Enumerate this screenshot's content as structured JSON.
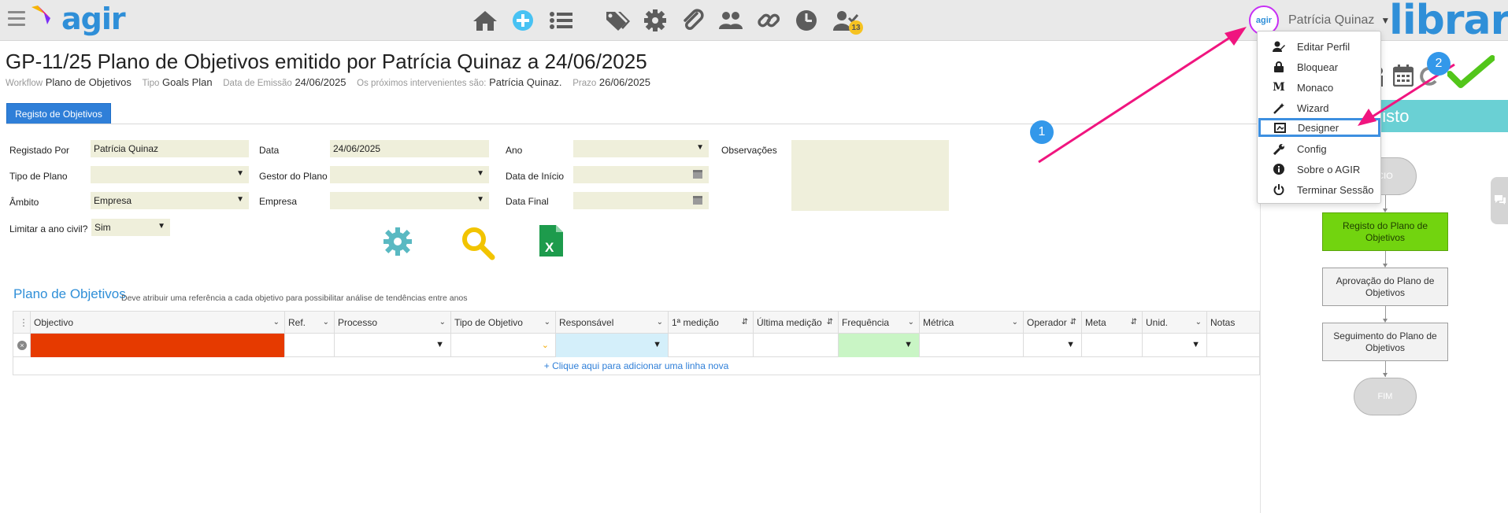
{
  "topbar": {
    "logo_text": "agir",
    "user_name": "Patrícia Quinaz",
    "user_avatar_text": "agir",
    "library_text": "library",
    "notification_count": "13",
    "nav_icons": [
      "home-icon",
      "add-icon",
      "list-icon",
      "tags-icon",
      "gear-icon",
      "attachment-icon",
      "users-icon",
      "link-icon",
      "clock-icon",
      "user-check-icon"
    ]
  },
  "page": {
    "title": "GP-11/25 Plano de Objetivos emitido por Patrícia Quinaz a 24/06/2025",
    "meta": {
      "workflow_label": "Workflow",
      "workflow_value": "Plano de Objetivos",
      "tipo_label": "Tipo",
      "tipo_value": "Goals Plan",
      "data_emissao_label": "Data de Emissão",
      "data_emissao_value": "24/06/2025",
      "intervenientes_label": "Os próximos intervenientes são:",
      "intervenientes_value": "Patrícia Quinaz.",
      "prazo_label": "Prazo",
      "prazo_value": "26/06/2025"
    },
    "tab_label": "Registo de Objetivos"
  },
  "form": {
    "registado_por_label": "Registado Por",
    "registado_por_value": "Patrícia Quinaz",
    "data_label": "Data",
    "data_value": "24/06/2025",
    "ano_label": "Ano",
    "ano_value": "",
    "observacoes_label": "Observações",
    "tipo_plano_label": "Tipo de Plano",
    "tipo_plano_value": "",
    "gestor_label": "Gestor do Plano",
    "gestor_value": "",
    "data_inicio_label": "Data de Início",
    "data_inicio_value": "",
    "ambito_label": "Âmbito",
    "ambito_value": "Empresa",
    "empresa_label": "Empresa",
    "empresa_value": "",
    "data_final_label": "Data Final",
    "data_final_value": "",
    "limitar_label": "Limitar a ano civil?",
    "limitar_value": "Sim"
  },
  "table": {
    "title": "Plano de Objetivos",
    "subtitle": "Deve atribuir uma referência a cada objetivo para possibilitar análise de tendências entre anos",
    "columns": [
      "Objectivo",
      "Ref.",
      "Processo",
      "Tipo de Objetivo",
      "Responsável",
      "1ª medição",
      "Última medição",
      "Frequência",
      "Métrica",
      "Operador",
      "Meta",
      "Unid.",
      "Notas"
    ],
    "add_row_text": "+ Clique aqui para adicionar uma linha nova"
  },
  "menu": {
    "items": [
      {
        "label": "Editar Perfil",
        "icon": "user-edit-icon"
      },
      {
        "label": "Bloquear",
        "icon": "lock-icon"
      },
      {
        "label": "Monaco",
        "icon": "monaco-icon"
      },
      {
        "label": "Wizard",
        "icon": "wand-icon"
      },
      {
        "label": "Designer",
        "icon": "designer-icon"
      },
      {
        "label": "Config",
        "icon": "wrench-icon"
      },
      {
        "label": "Sobre o AGIR",
        "icon": "info-icon"
      },
      {
        "label": "Terminar Sessão",
        "icon": "power-icon"
      }
    ],
    "highlighted": "Designer"
  },
  "workflow": {
    "panel_title_fragment": "gisto",
    "start_label": "CIO",
    "nodes": [
      "Registo do Plano de Objetivos",
      "Aprovação do Plano de Objetivos",
      "Seguimento do Plano de Objetivos"
    ],
    "end_label": "FIM"
  },
  "annotations": {
    "badge_1": "1",
    "badge_2": "2",
    "arrow_color": "#f0157f"
  },
  "colors": {
    "brand_blue": "#2f8fd8",
    "field_bg": "#efefdb",
    "red_cell": "#e63a00",
    "blue_cell": "#d4effa",
    "green_cell": "#c9f5c5",
    "teal": "#6ad0d4",
    "node_green": "#72d40f"
  }
}
